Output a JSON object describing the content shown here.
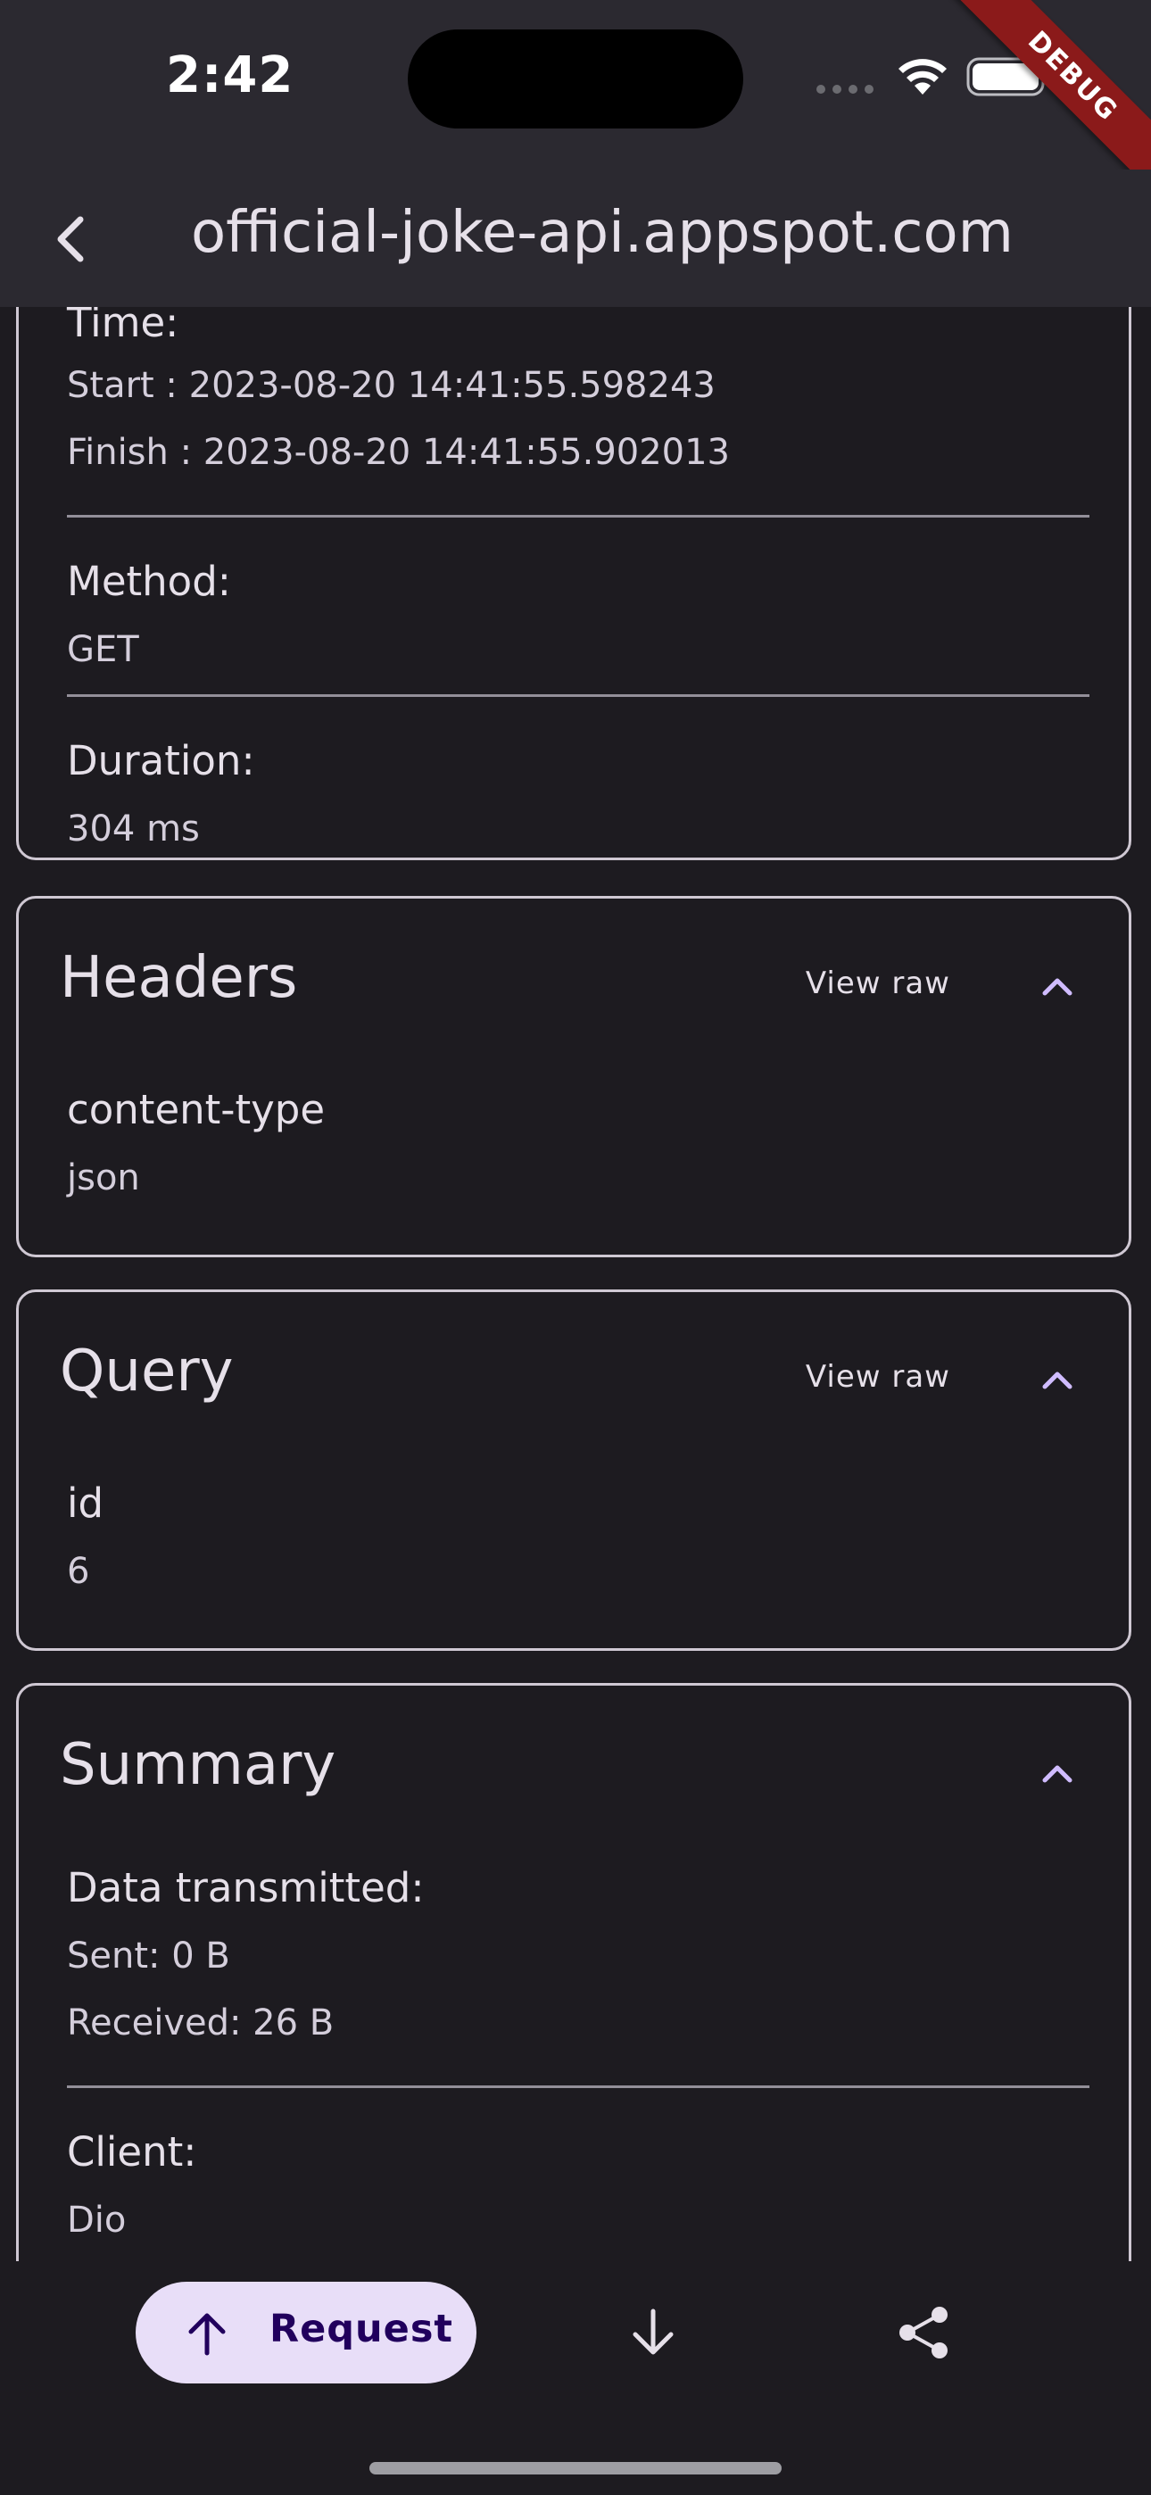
{
  "status_bar": {
    "time": "2:42",
    "debug_banner": "DEBUG"
  },
  "app_bar": {
    "title": "official-joke-api.appspot.com"
  },
  "overview_card": {
    "time_label": "Time:",
    "start": "Start : 2023-08-20 14:41:55.598243",
    "finish": "Finish : 2023-08-20 14:41:55.902013",
    "method_label": "Method:",
    "method_value": "GET",
    "duration_label": "Duration:",
    "duration_value": "304 ms"
  },
  "headers_card": {
    "title": "Headers",
    "view_raw": "View raw",
    "items": [
      {
        "key": "content-type",
        "value": "json"
      }
    ]
  },
  "query_card": {
    "title": "Query",
    "view_raw": "View raw",
    "items": [
      {
        "key": "id",
        "value": "6"
      }
    ]
  },
  "summary_card": {
    "title": "Summary",
    "data_label": "Data transmitted:",
    "sent": "Sent: 0 B",
    "received": "Received: 26 B",
    "client_label": "Client:",
    "client_value": "Dio"
  },
  "bottom_nav": {
    "request_label": "Request",
    "response_icon": "arrow-down-icon",
    "share_icon": "share-icon"
  },
  "colors": {
    "background": "#1d1b20",
    "app_bar": "#2b2930",
    "accent": "#d0bcff",
    "button_fill": "#e8def8",
    "button_text": "#21005d",
    "debug": "#8b1a1a"
  }
}
